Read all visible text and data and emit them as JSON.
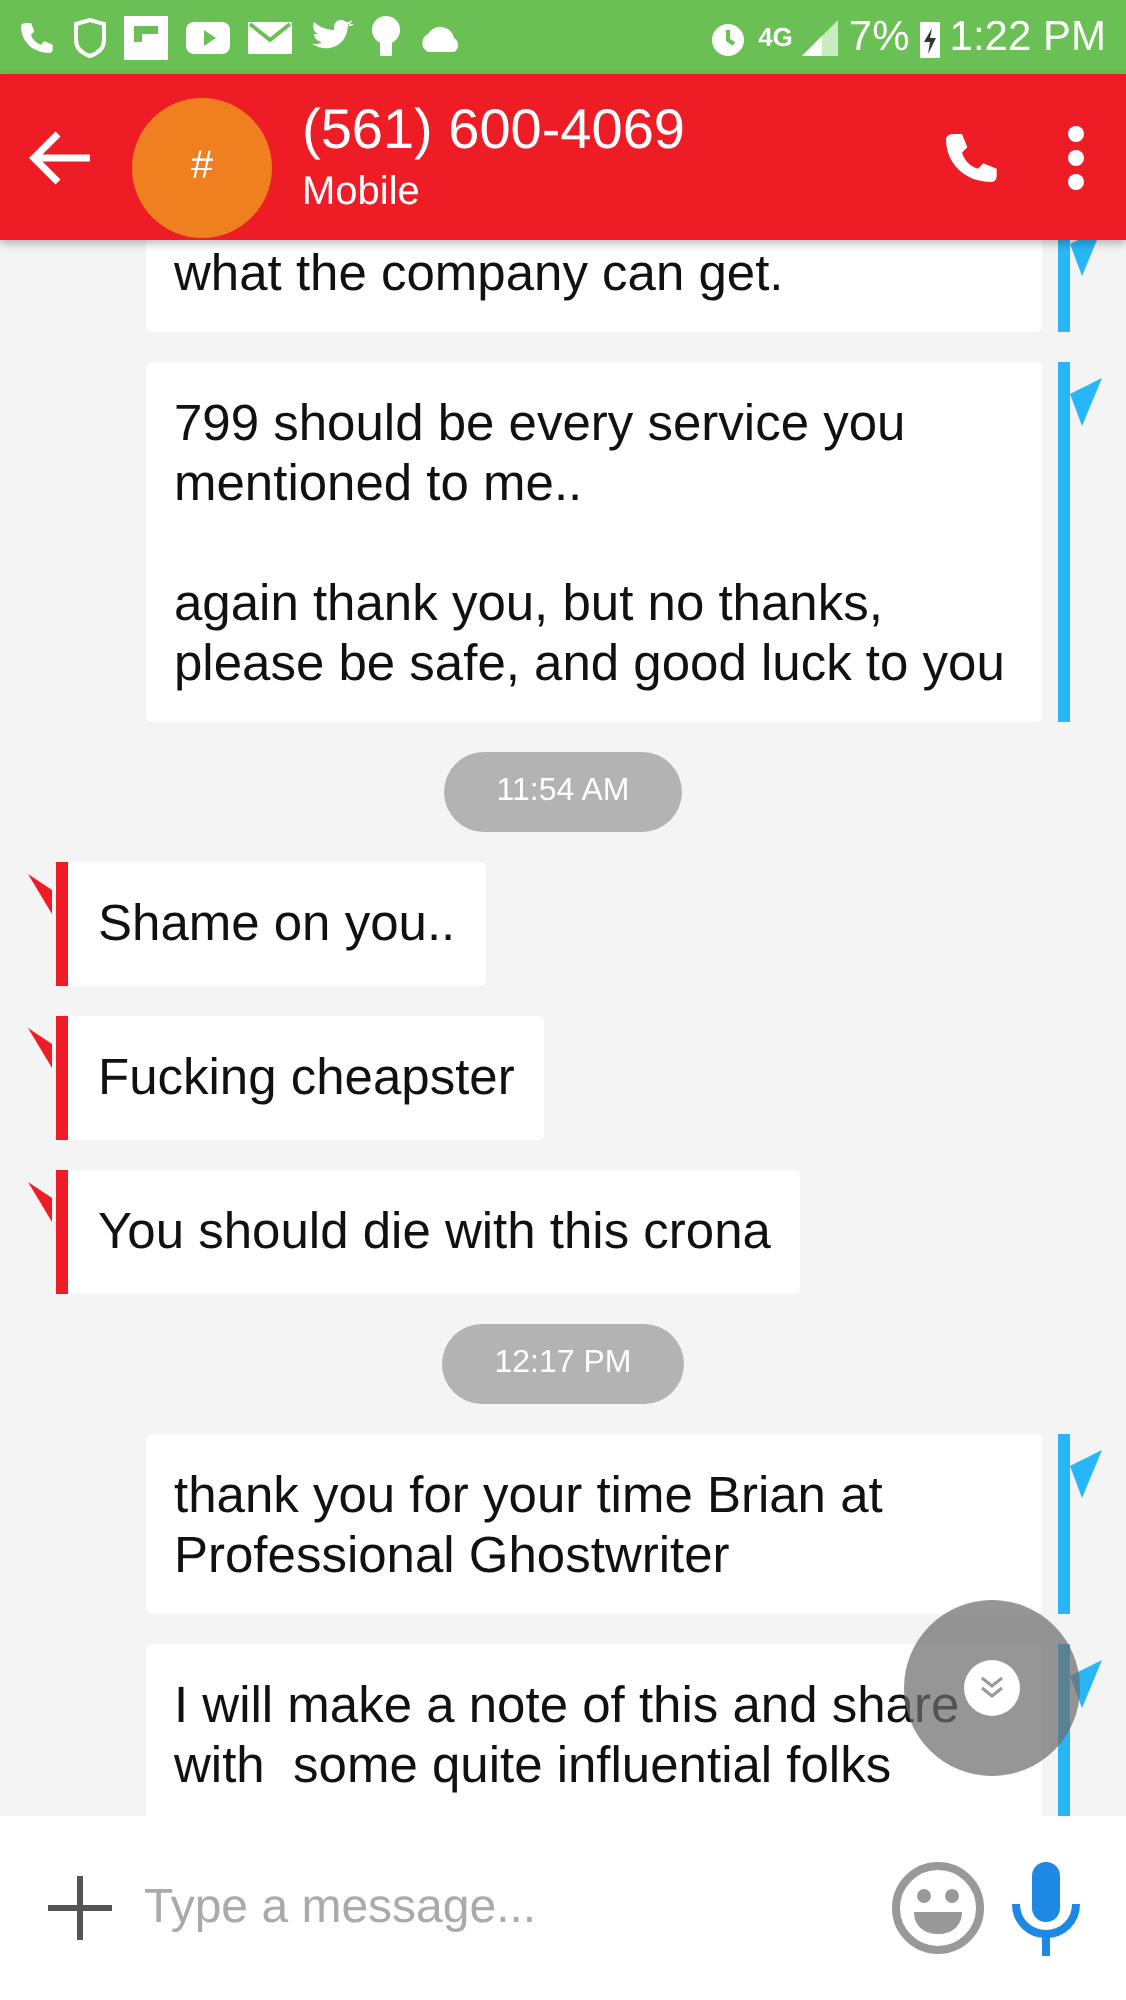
{
  "status_bar": {
    "network": "4G",
    "battery": "7%",
    "time": "1:22 PM"
  },
  "header": {
    "avatar": "#",
    "title": "(561) 600-4069",
    "subtitle": "Mobile"
  },
  "messages": [
    {
      "kind": "out",
      "text": "what the company can get."
    },
    {
      "kind": "out",
      "text": "799 should be every service you mentioned to me..\n\nagain thank you, but no thanks, please be safe, and good luck to you"
    },
    {
      "kind": "time",
      "text": "11:54 AM"
    },
    {
      "kind": "in",
      "text": "Shame on you.."
    },
    {
      "kind": "in",
      "text": "Fucking cheapster"
    },
    {
      "kind": "in",
      "text": "You should die with this crona"
    },
    {
      "kind": "time",
      "text": "12:17 PM"
    },
    {
      "kind": "out",
      "text": "thank you for your time Brian at Professional Ghostwriter"
    },
    {
      "kind": "out",
      "text": "I will make a note of this and share\nwith  some quite influential folks"
    }
  ],
  "composer": {
    "placeholder": "Type a message..."
  }
}
